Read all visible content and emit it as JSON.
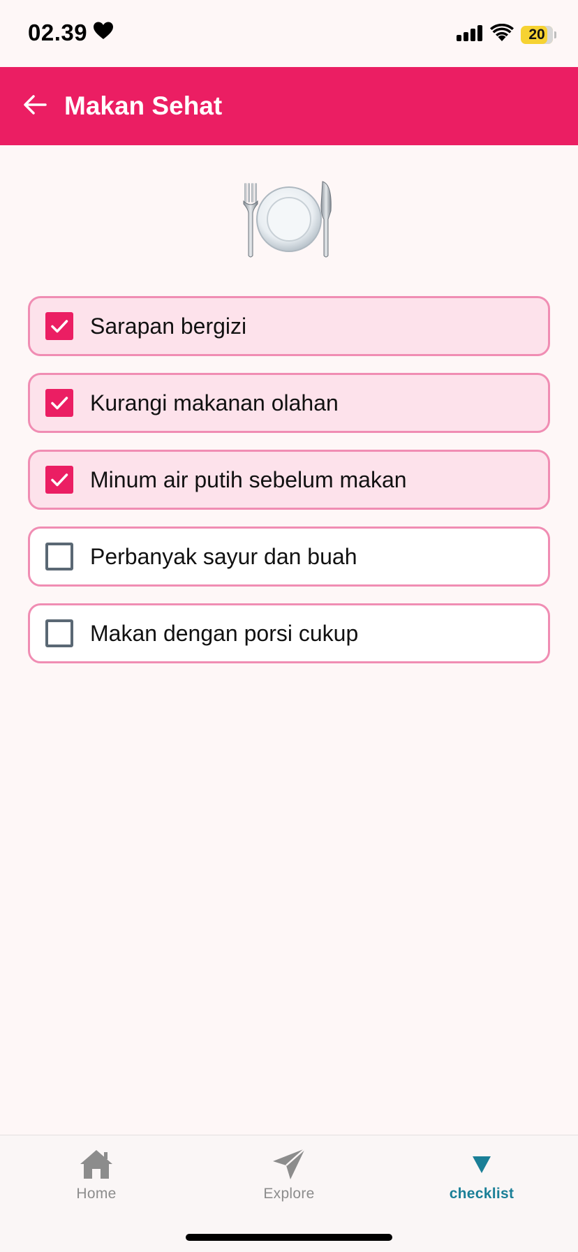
{
  "status_bar": {
    "time": "02.39",
    "battery": "20"
  },
  "app_bar": {
    "title": "Makan Sehat",
    "back_icon": "arrow-left-icon"
  },
  "hero": {
    "icon": "fork-knife-plate-icon"
  },
  "checklist": [
    {
      "label": "Sarapan bergizi",
      "checked": true
    },
    {
      "label": "Kurangi makanan olahan",
      "checked": true
    },
    {
      "label": "Minum air putih sebelum makan",
      "checked": true
    },
    {
      "label": "Perbanyak sayur dan buah",
      "checked": false
    },
    {
      "label": "Makan dengan porsi cukup",
      "checked": false
    }
  ],
  "bottom_nav": {
    "items": [
      {
        "label": "Home",
        "icon": "home-icon",
        "active": false
      },
      {
        "label": "Explore",
        "icon": "paper-plane-icon",
        "active": false
      },
      {
        "label": "checklist",
        "icon": "triangle-down-icon",
        "active": true
      }
    ]
  },
  "colors": {
    "primary": "#EB1E63",
    "item_border": "#F08DB3",
    "checked_item_bg": "#FDE2EB",
    "active_nav": "#1A7F97",
    "background": "#FEF7F7"
  }
}
